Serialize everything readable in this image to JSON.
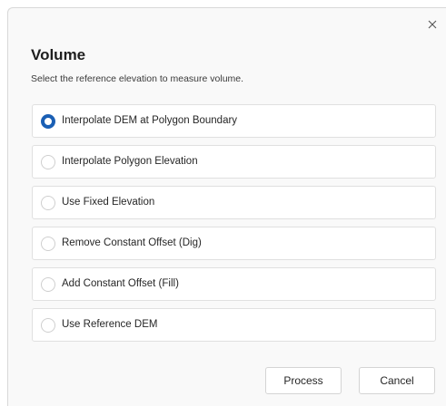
{
  "dialog": {
    "title": "Volume",
    "subtitle": "Select the reference elevation to measure volume.",
    "close_icon": "close-icon",
    "options": [
      {
        "label": "Interpolate DEM at Polygon Boundary",
        "selected": true
      },
      {
        "label": "Interpolate Polygon Elevation",
        "selected": false
      },
      {
        "label": "Use Fixed Elevation",
        "selected": false
      },
      {
        "label": "Remove Constant Offset (Dig)",
        "selected": false
      },
      {
        "label": "Add Constant Offset (Fill)",
        "selected": false
      },
      {
        "label": "Use Reference DEM",
        "selected": false
      }
    ],
    "buttons": {
      "process": "Process",
      "cancel": "Cancel"
    },
    "colors": {
      "accent": "#1a5fb4",
      "background": "#f9f9f9"
    }
  }
}
